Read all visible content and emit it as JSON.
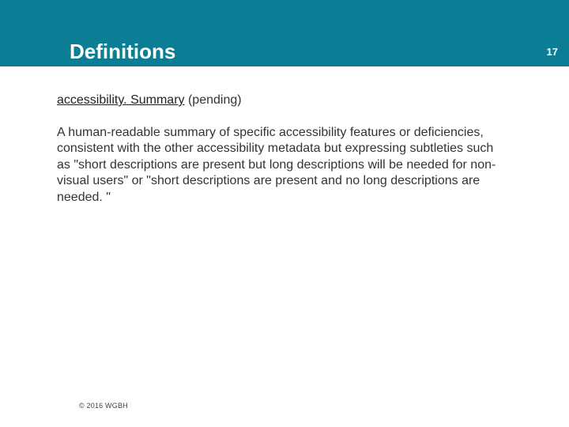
{
  "header": {
    "title": "Definitions",
    "page_number": "17"
  },
  "content": {
    "term": "accessibility. Summary",
    "status": "(pending)",
    "body": "A human-readable summary of specific accessibility features or deficiencies, consistent with the other accessibility metadata but expressing subtleties such as \"short descriptions are present but long descriptions will be needed for non-visual users\" or \"short descriptions are present and no long descriptions are needed. \""
  },
  "footer": {
    "copyright": "© 2016 WGBH"
  }
}
